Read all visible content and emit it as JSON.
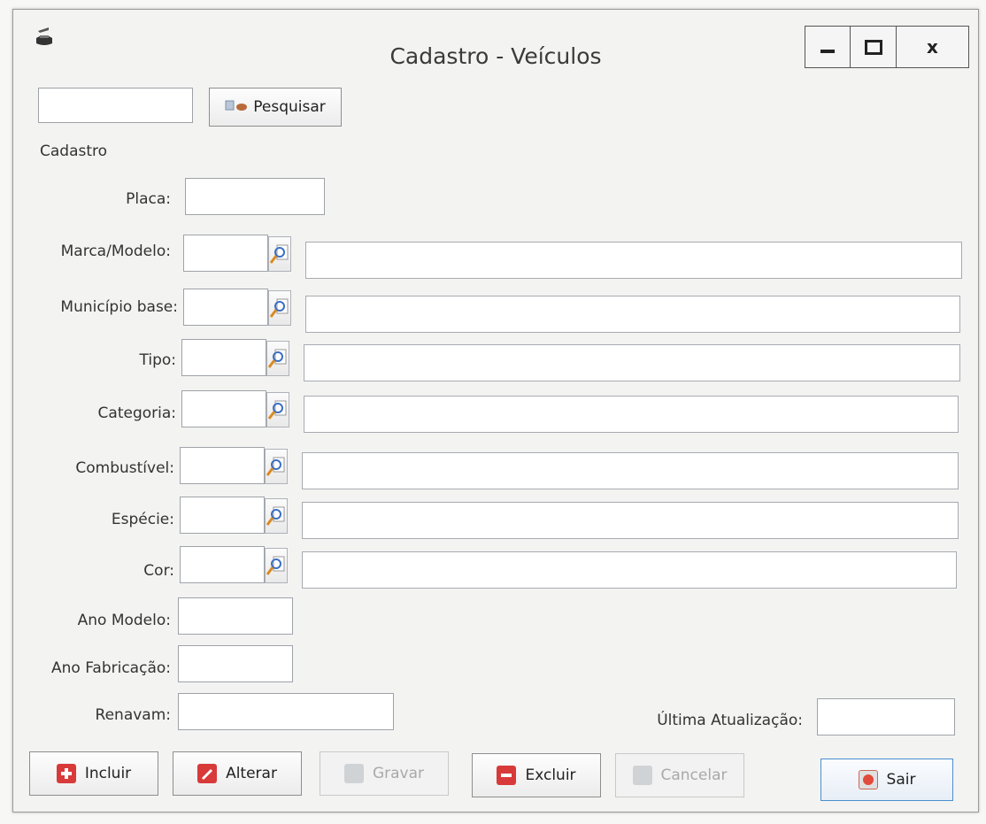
{
  "window": {
    "title": "Cadastro - Veículos",
    "minimize_glyph": "minimize-icon",
    "maximize_glyph": "maximize-icon",
    "close_glyph": "x"
  },
  "search": {
    "value": "",
    "button_label": "Pesquisar"
  },
  "section": {
    "title": "Cadastro"
  },
  "fields": {
    "placa": "Placa:",
    "marca_modelo": "Marca/Modelo:",
    "municipio_base": "Município base:",
    "tipo": "Tipo:",
    "categoria": "Categoria:",
    "combustivel": "Combustível:",
    "especie": "Espécie:",
    "cor": "Cor:",
    "ano_modelo": "Ano Modelo:",
    "ano_fabricacao": "Ano Fabricação:",
    "renavam": "Renavam:",
    "ultima_atualizacao": "Última Atualização:"
  },
  "buttons": {
    "incluir": "Incluir",
    "alterar": "Alterar",
    "gravar": "Gravar",
    "excluir": "Excluir",
    "cancelar": "Cancelar",
    "sair": "Sair"
  },
  "colors": {
    "window_bg": "#f3f3f2",
    "field_border": "#9ea3a8",
    "action_red": "#d83a3a",
    "focus_blue": "#4a8fd0"
  }
}
